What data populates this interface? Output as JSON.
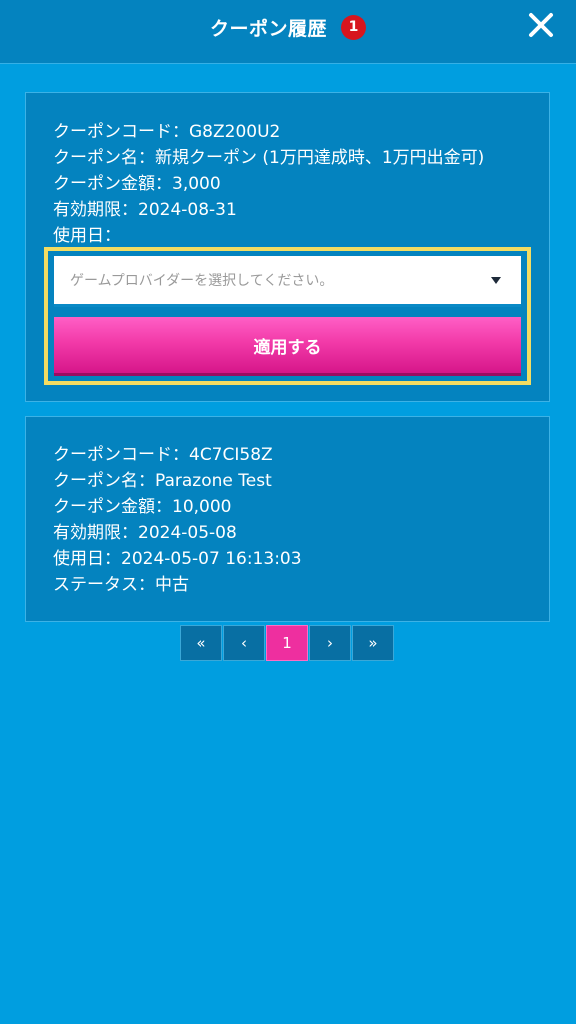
{
  "header": {
    "title": "クーポン履歴",
    "badge_count": "1"
  },
  "coupons": [
    {
      "code": "クーポンコード：G8Z200U2",
      "name": "クーポン名：新規クーポン (1万円達成時、1万円出金可)",
      "amount": "クーポン金額：3,000",
      "expiry": "有効期限：2024-08-31",
      "used_date": "使用日：",
      "provider_placeholder": "ゲームプロバイダーを選択してください。",
      "apply_label": "適用する"
    },
    {
      "code": "クーポンコード：4C7CI58Z",
      "name": "クーポン名：Parazone Test",
      "amount": "クーポン金額：10,000",
      "expiry": "有効期限：2024-05-08",
      "used_date": "使用日：2024-05-07 16:13:03",
      "status": "ステータス：中古"
    }
  ],
  "pagination": {
    "first": "«",
    "prev": "‹",
    "current": "1",
    "next": "›",
    "last": "»"
  },
  "icons": {
    "close": "close-icon",
    "dropdown": "caret-down-icon"
  },
  "colors": {
    "background": "#009ee0",
    "card": "#0483bf",
    "accent_pink": "#ee2f9f",
    "highlight_border": "#f3dc62",
    "badge_red": "#d7151e"
  }
}
